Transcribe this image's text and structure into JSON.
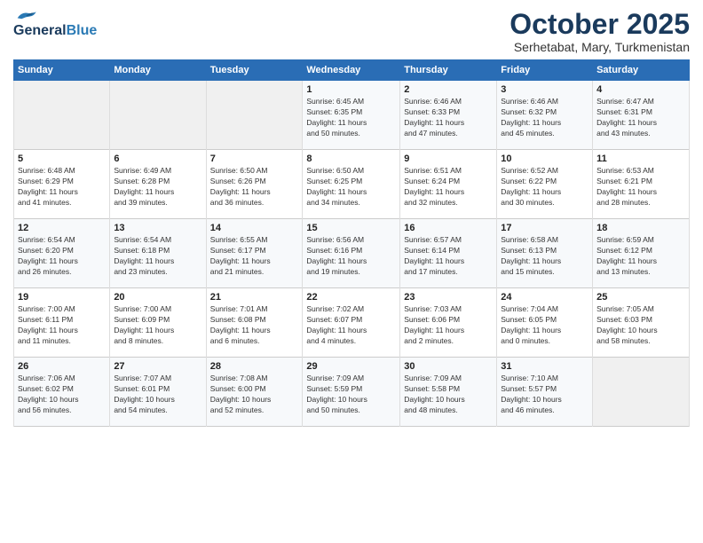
{
  "header": {
    "logo_general": "General",
    "logo_blue": "Blue",
    "month_title": "October 2025",
    "subtitle": "Serhetabat, Mary, Turkmenistan"
  },
  "days_of_week": [
    "Sunday",
    "Monday",
    "Tuesday",
    "Wednesday",
    "Thursday",
    "Friday",
    "Saturday"
  ],
  "weeks": [
    [
      {
        "day": "",
        "info": ""
      },
      {
        "day": "",
        "info": ""
      },
      {
        "day": "",
        "info": ""
      },
      {
        "day": "1",
        "info": "Sunrise: 6:45 AM\nSunset: 6:35 PM\nDaylight: 11 hours\nand 50 minutes."
      },
      {
        "day": "2",
        "info": "Sunrise: 6:46 AM\nSunset: 6:33 PM\nDaylight: 11 hours\nand 47 minutes."
      },
      {
        "day": "3",
        "info": "Sunrise: 6:46 AM\nSunset: 6:32 PM\nDaylight: 11 hours\nand 45 minutes."
      },
      {
        "day": "4",
        "info": "Sunrise: 6:47 AM\nSunset: 6:31 PM\nDaylight: 11 hours\nand 43 minutes."
      }
    ],
    [
      {
        "day": "5",
        "info": "Sunrise: 6:48 AM\nSunset: 6:29 PM\nDaylight: 11 hours\nand 41 minutes."
      },
      {
        "day": "6",
        "info": "Sunrise: 6:49 AM\nSunset: 6:28 PM\nDaylight: 11 hours\nand 39 minutes."
      },
      {
        "day": "7",
        "info": "Sunrise: 6:50 AM\nSunset: 6:26 PM\nDaylight: 11 hours\nand 36 minutes."
      },
      {
        "day": "8",
        "info": "Sunrise: 6:50 AM\nSunset: 6:25 PM\nDaylight: 11 hours\nand 34 minutes."
      },
      {
        "day": "9",
        "info": "Sunrise: 6:51 AM\nSunset: 6:24 PM\nDaylight: 11 hours\nand 32 minutes."
      },
      {
        "day": "10",
        "info": "Sunrise: 6:52 AM\nSunset: 6:22 PM\nDaylight: 11 hours\nand 30 minutes."
      },
      {
        "day": "11",
        "info": "Sunrise: 6:53 AM\nSunset: 6:21 PM\nDaylight: 11 hours\nand 28 minutes."
      }
    ],
    [
      {
        "day": "12",
        "info": "Sunrise: 6:54 AM\nSunset: 6:20 PM\nDaylight: 11 hours\nand 26 minutes."
      },
      {
        "day": "13",
        "info": "Sunrise: 6:54 AM\nSunset: 6:18 PM\nDaylight: 11 hours\nand 23 minutes."
      },
      {
        "day": "14",
        "info": "Sunrise: 6:55 AM\nSunset: 6:17 PM\nDaylight: 11 hours\nand 21 minutes."
      },
      {
        "day": "15",
        "info": "Sunrise: 6:56 AM\nSunset: 6:16 PM\nDaylight: 11 hours\nand 19 minutes."
      },
      {
        "day": "16",
        "info": "Sunrise: 6:57 AM\nSunset: 6:14 PM\nDaylight: 11 hours\nand 17 minutes."
      },
      {
        "day": "17",
        "info": "Sunrise: 6:58 AM\nSunset: 6:13 PM\nDaylight: 11 hours\nand 15 minutes."
      },
      {
        "day": "18",
        "info": "Sunrise: 6:59 AM\nSunset: 6:12 PM\nDaylight: 11 hours\nand 13 minutes."
      }
    ],
    [
      {
        "day": "19",
        "info": "Sunrise: 7:00 AM\nSunset: 6:11 PM\nDaylight: 11 hours\nand 11 minutes."
      },
      {
        "day": "20",
        "info": "Sunrise: 7:00 AM\nSunset: 6:09 PM\nDaylight: 11 hours\nand 8 minutes."
      },
      {
        "day": "21",
        "info": "Sunrise: 7:01 AM\nSunset: 6:08 PM\nDaylight: 11 hours\nand 6 minutes."
      },
      {
        "day": "22",
        "info": "Sunrise: 7:02 AM\nSunset: 6:07 PM\nDaylight: 11 hours\nand 4 minutes."
      },
      {
        "day": "23",
        "info": "Sunrise: 7:03 AM\nSunset: 6:06 PM\nDaylight: 11 hours\nand 2 minutes."
      },
      {
        "day": "24",
        "info": "Sunrise: 7:04 AM\nSunset: 6:05 PM\nDaylight: 11 hours\nand 0 minutes."
      },
      {
        "day": "25",
        "info": "Sunrise: 7:05 AM\nSunset: 6:03 PM\nDaylight: 10 hours\nand 58 minutes."
      }
    ],
    [
      {
        "day": "26",
        "info": "Sunrise: 7:06 AM\nSunset: 6:02 PM\nDaylight: 10 hours\nand 56 minutes."
      },
      {
        "day": "27",
        "info": "Sunrise: 7:07 AM\nSunset: 6:01 PM\nDaylight: 10 hours\nand 54 minutes."
      },
      {
        "day": "28",
        "info": "Sunrise: 7:08 AM\nSunset: 6:00 PM\nDaylight: 10 hours\nand 52 minutes."
      },
      {
        "day": "29",
        "info": "Sunrise: 7:09 AM\nSunset: 5:59 PM\nDaylight: 10 hours\nand 50 minutes."
      },
      {
        "day": "30",
        "info": "Sunrise: 7:09 AM\nSunset: 5:58 PM\nDaylight: 10 hours\nand 48 minutes."
      },
      {
        "day": "31",
        "info": "Sunrise: 7:10 AM\nSunset: 5:57 PM\nDaylight: 10 hours\nand 46 minutes."
      },
      {
        "day": "",
        "info": ""
      }
    ]
  ]
}
